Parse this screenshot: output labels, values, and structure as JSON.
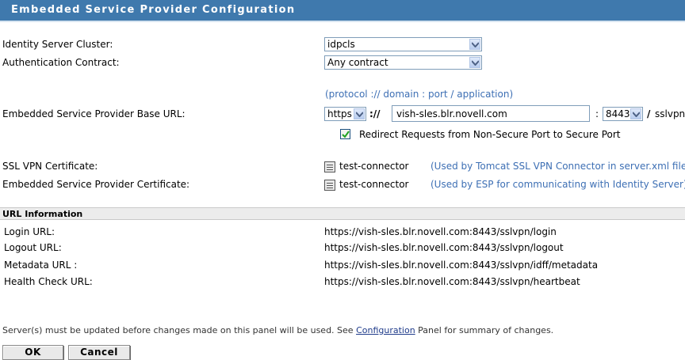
{
  "header": {
    "title": "Embedded Service Provider Configuration"
  },
  "form": {
    "identity_cluster": {
      "label": "Identity Server Cluster:",
      "value": "idpcls"
    },
    "auth_contract": {
      "label": "Authentication Contract:",
      "value": "Any contract"
    },
    "url_hint": "(protocol :// domain : port / application)",
    "base_url": {
      "label": "Embedded Service Provider Base URL:",
      "protocol": "https",
      "separator": "://",
      "domain": "vish-sles.blr.novell.com",
      "port_separator": ":",
      "port": "8443",
      "app_prefix": "/",
      "application": "sslvpn"
    },
    "redirect": {
      "label": "Redirect Requests from Non-Secure Port to Secure Port",
      "checked": true
    },
    "ssl_cert": {
      "label": "SSL VPN Certificate:",
      "value": "test-connector",
      "note": "(Used by Tomcat SSL VPN Connector in server.xml file)"
    },
    "esp_cert": {
      "label": "Embedded Service Provider Certificate:",
      "value": "test-connector",
      "note": "(Used by ESP for communicating with Identity Server):"
    }
  },
  "url_info": {
    "title": "URL Information",
    "rows": [
      {
        "label": "Login URL:",
        "value": "https://vish-sles.blr.novell.com:8443/sslvpn/login"
      },
      {
        "label": "Logout URL:",
        "value": "https://vish-sles.blr.novell.com:8443/sslvpn/logout"
      },
      {
        "label": "Metadata URL :",
        "value": "https://vish-sles.blr.novell.com:8443/sslvpn/idff/metadata"
      },
      {
        "label": "Health Check URL:",
        "value": "https://vish-sles.blr.novell.com:8443/sslvpn/heartbeat"
      }
    ]
  },
  "footer": {
    "note_prefix": "Server(s) must be updated before changes made on this panel will be used. See ",
    "note_link": "Configuration",
    "note_suffix": " Panel for summary of changes.",
    "ok_label": "OK",
    "cancel_label": "Cancel"
  },
  "colors": {
    "title_bar": "#3f79ad",
    "hint": "#3d6fb4",
    "link": "#1f3b8a"
  }
}
